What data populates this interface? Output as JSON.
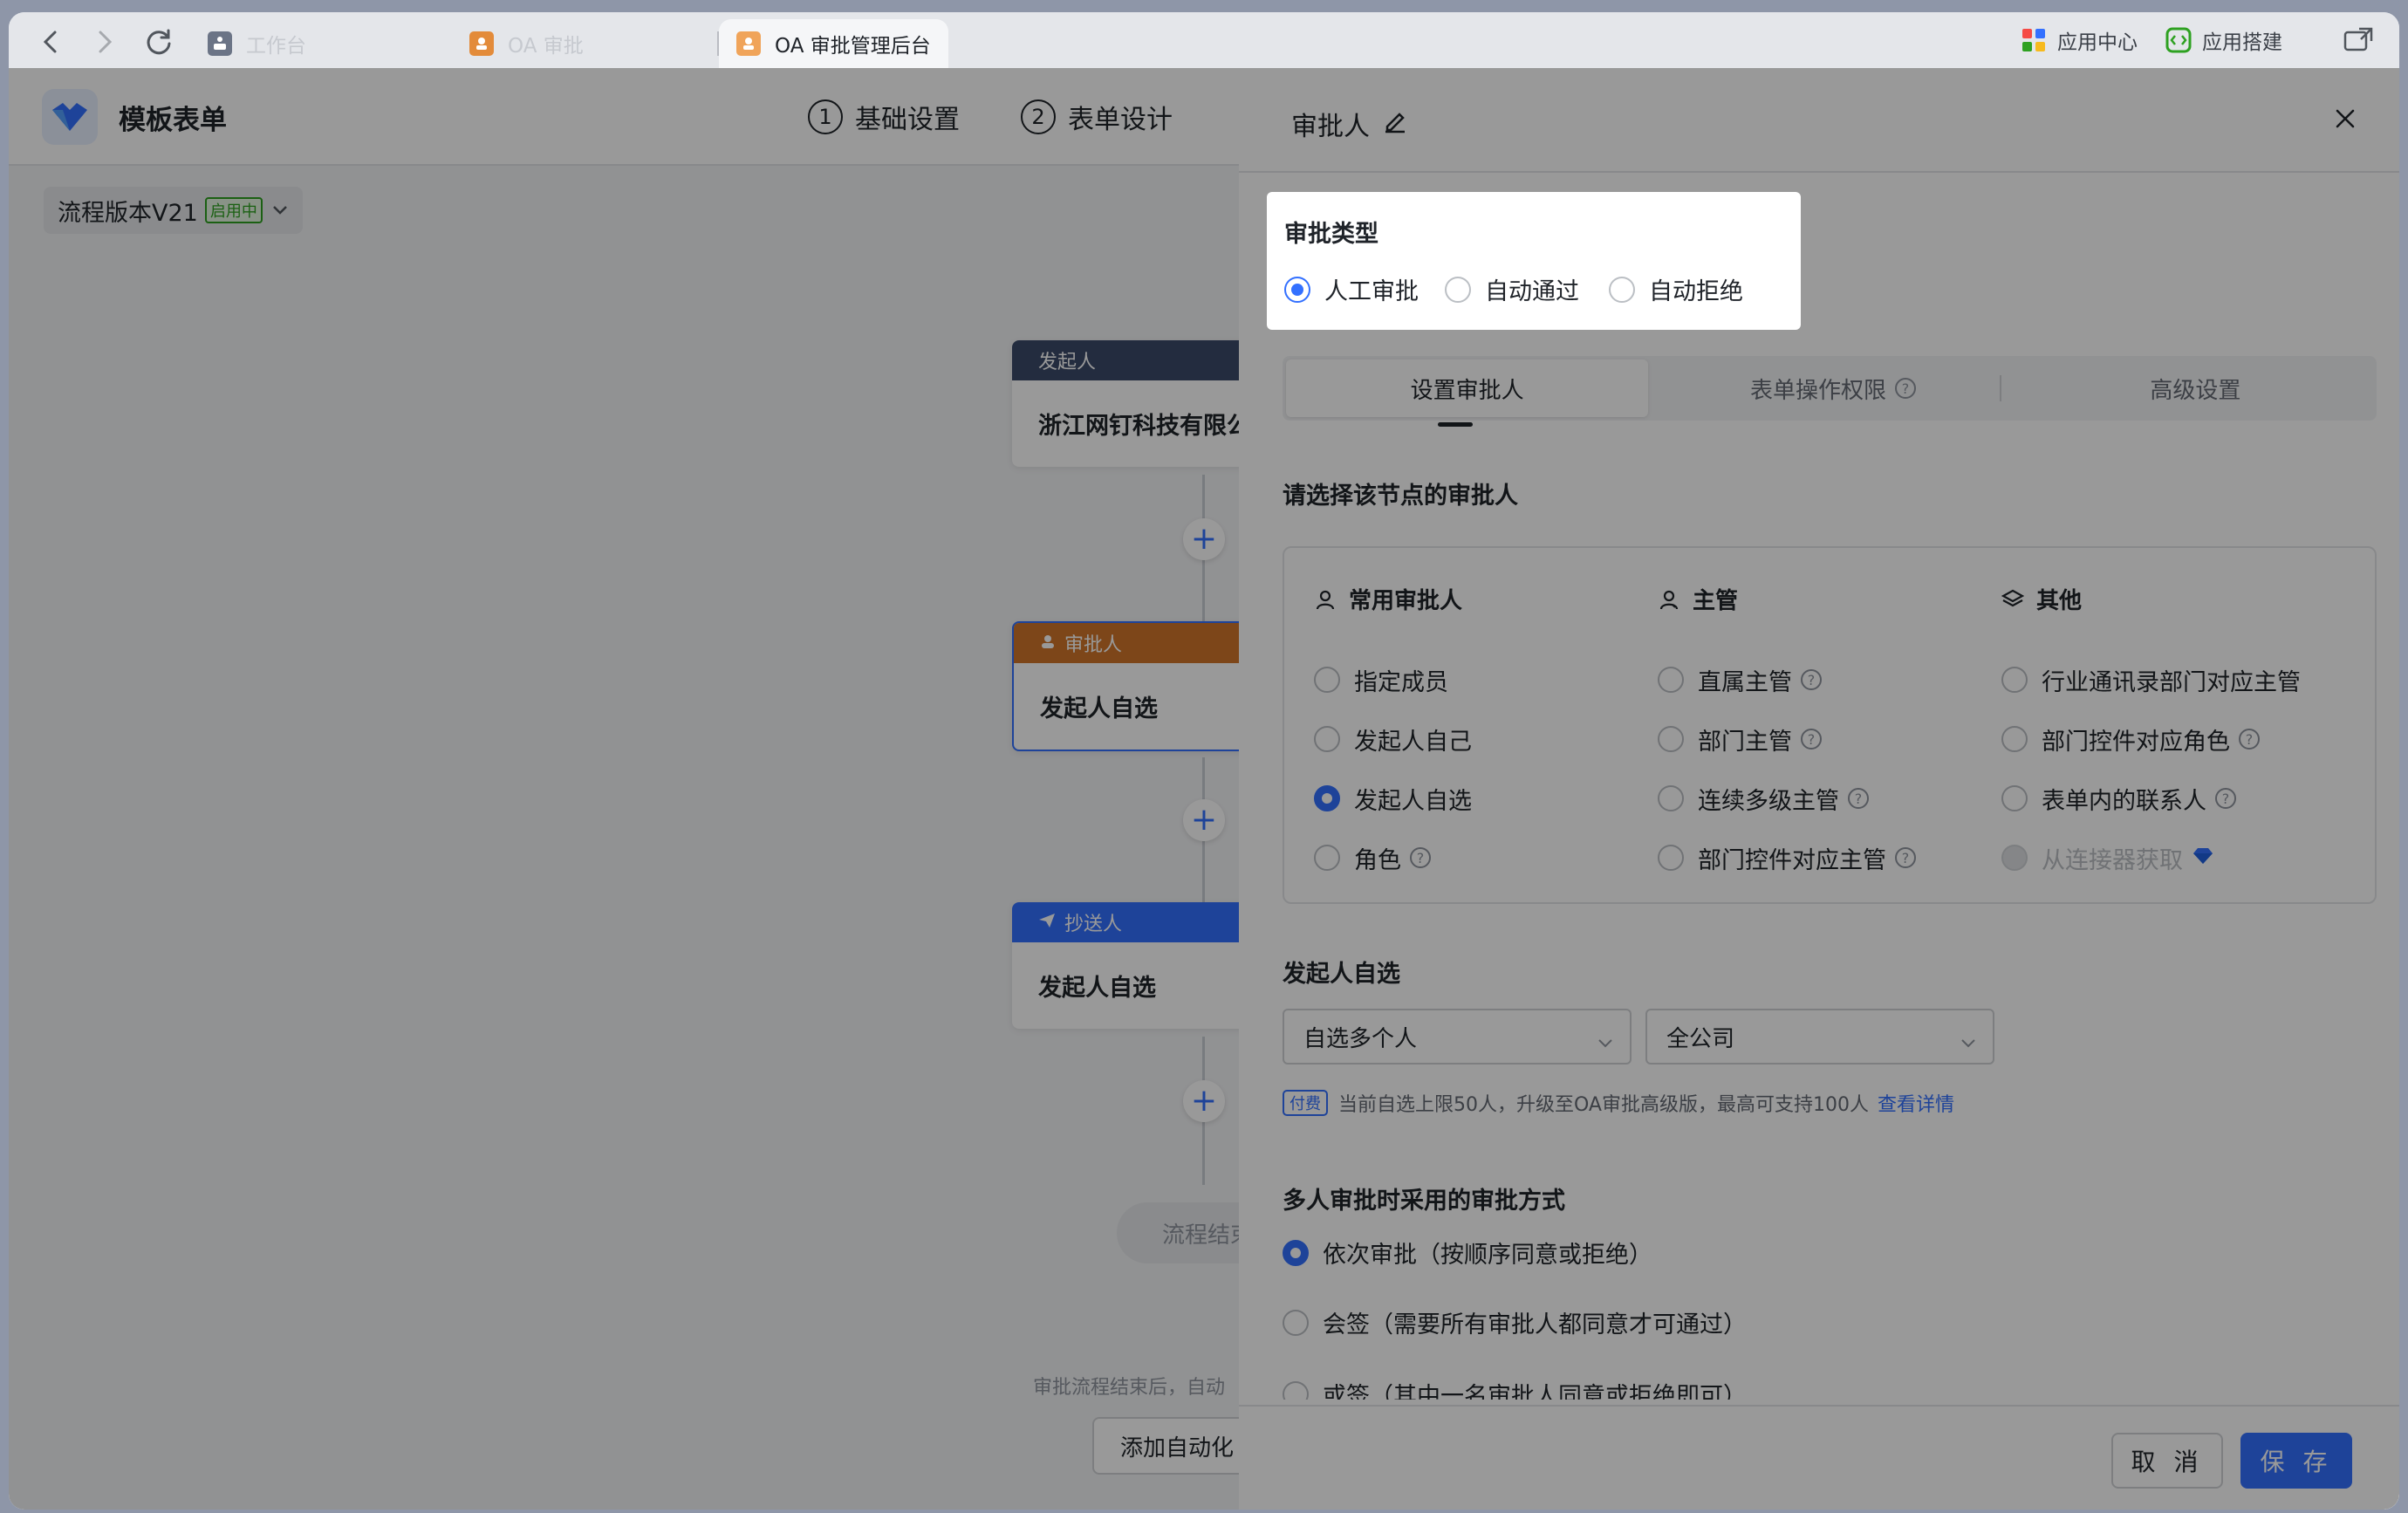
{
  "browser": {
    "tabs": [
      {
        "label": "工作台",
        "active": false
      },
      {
        "label": "OA 审批",
        "active": false
      },
      {
        "label": "OA 审批管理后台",
        "active": true
      }
    ],
    "right_items": [
      "应用中心",
      "应用搭建"
    ]
  },
  "app": {
    "title": "模板表单",
    "steps": [
      {
        "num": "1",
        "label": "基础设置"
      },
      {
        "num": "2",
        "label": "表单设计"
      }
    ],
    "version": "流程版本V21",
    "version_badge": "启用中",
    "flow": {
      "initiator": {
        "head": "发起人",
        "body": "浙江网钉科技有限公"
      },
      "approver": {
        "head": "审批人",
        "body": "发起人自选"
      },
      "cc": {
        "head": "抄送人",
        "body": "发起人自选"
      },
      "end": "流程结束",
      "end_note": "审批流程结束后，自动",
      "add_auto": "添加自动化"
    },
    "colors": {
      "initiator": "#3b4a6a",
      "approver": "#d0752a",
      "cc": "#3370ff"
    }
  },
  "drawer": {
    "title": "审批人",
    "approval_type": {
      "title": "审批类型",
      "options": [
        "人工审批",
        "自动通过",
        "自动拒绝"
      ],
      "selected": "人工审批"
    },
    "tabs": [
      "设置审批人",
      "表单操作权限",
      "高级设置"
    ],
    "active_tab": "设置审批人",
    "choose_title": "请选择该节点的审批人",
    "columns": [
      {
        "head": "常用审批人",
        "icon": "user-icon",
        "items": [
          {
            "label": "指定成员",
            "help": false
          },
          {
            "label": "发起人自己",
            "help": false
          },
          {
            "label": "发起人自选",
            "help": false,
            "selected": true
          },
          {
            "label": "角色",
            "help": true
          }
        ]
      },
      {
        "head": "主管",
        "icon": "manager-icon",
        "items": [
          {
            "label": "直属主管",
            "help": true
          },
          {
            "label": "部门主管",
            "help": true
          },
          {
            "label": "连续多级主管",
            "help": true
          },
          {
            "label": "部门控件对应主管",
            "help": true
          }
        ]
      },
      {
        "head": "其他",
        "icon": "layers-icon",
        "items": [
          {
            "label": "行业通讯录部门对应主管",
            "help": false
          },
          {
            "label": "部门控件对应角色",
            "help": true
          },
          {
            "label": "表单内的联系人",
            "help": true
          },
          {
            "label": "从连接器获取",
            "help": false,
            "disabled": true
          }
        ]
      }
    ],
    "self_select": {
      "title": "发起人自选",
      "mode": "自选多个人",
      "scope": "全公司",
      "pay_tag": "付费",
      "note": "当前自选上限50人，升级至OA审批高级版，最高可支持100人",
      "note_link": "查看详情"
    },
    "multi": {
      "title": "多人审批时采用的审批方式",
      "options": [
        "依次审批（按顺序同意或拒绝）",
        "会签（需要所有审批人都同意才可通过）",
        "或签（其中一名审批人同意或拒绝即可）"
      ],
      "selected": 0
    },
    "footer": {
      "cancel": "取 消",
      "save": "保 存"
    }
  }
}
